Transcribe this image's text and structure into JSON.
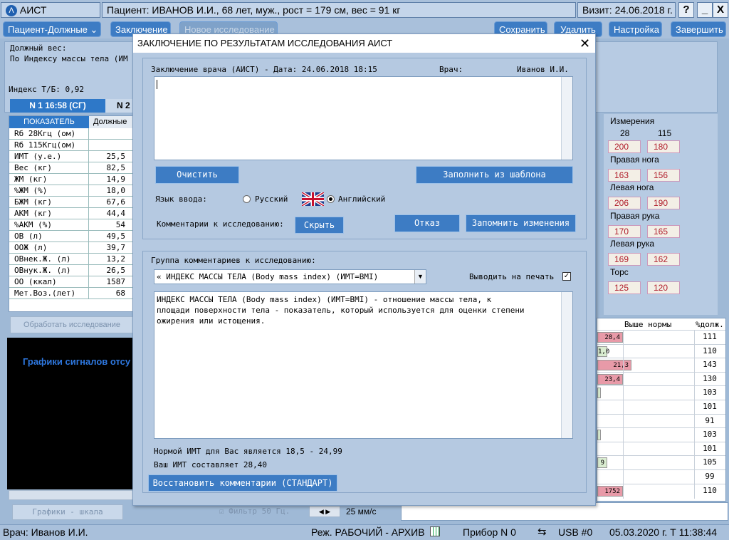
{
  "app": {
    "title": "АИСТ",
    "patient_label": "Пациент:",
    "patient": "ИВАНОВ И.И., 68 лет, муж., рост = 179 см, вес = 91 кг",
    "visit_label": "Визит:",
    "visit_date": "24.06.2018 г.",
    "help": "?",
    "minimize": "_",
    "close": "X"
  },
  "toolbar": {
    "mode": "Пациент-Должные",
    "conclusion": "Заключение",
    "new_study": "Новое исследование",
    "save": "Сохранить",
    "delete": "Удалить",
    "settings": "Настройка",
    "exit": "Завершить"
  },
  "left": {
    "due_weight": "Должный вес:",
    "bmi_ref": "По Индексу массы тела (ИМ",
    "index_tb": "Индекс Т/Б:  0,92",
    "tab1": "N 1  16:58 (СГ)",
    "tab2": "N 2",
    "col_indicator": "ПОКАЗАТЕЛЬ",
    "col_due": "Должные",
    "rows": [
      {
        "name": "Rб 28Кгц  (ом)",
        "val": ""
      },
      {
        "name": "Rб 115Кгц(ом)",
        "val": ""
      },
      {
        "name": "ИМТ     (у.е.)",
        "val": "25,5"
      },
      {
        "name": "Вес       (кг)",
        "val": "82,5"
      },
      {
        "name": "ЖМ        (кг)",
        "val": "14,9"
      },
      {
        "name": "%ЖМ        (%)",
        "val": "18,0"
      },
      {
        "name": "БЖМ       (кг)",
        "val": "67,6"
      },
      {
        "name": "АКМ       (кг)",
        "val": "44,4"
      },
      {
        "name": "%АКМ       (%)",
        "val": "54"
      },
      {
        "name": "ОВ         (л)",
        "val": "49,5"
      },
      {
        "name": "ООЖ        (л)",
        "val": "39,7"
      },
      {
        "name": "ОВнек.Ж.   (л)",
        "val": "13,2"
      },
      {
        "name": "ОВнук.Ж.   (л)",
        "val": "26,5"
      },
      {
        "name": "ОО      (ккал)",
        "val": "1587"
      },
      {
        "name": "Мет.Воз.(лет)",
        "val": "68"
      }
    ],
    "process": "Обработать исследование",
    "no_signals": "Графики сигналов отсу",
    "graphs_scale": "Графики - шкала",
    "filter": "Фильтр 50 Гц.",
    "speed": "25 мм/с"
  },
  "measure": {
    "title": "Измерения",
    "f1": "28",
    "f2": "115",
    "groups": [
      {
        "label": "",
        "a": "200",
        "b": "180"
      },
      {
        "label": "Правая нога",
        "a": "163",
        "b": "156"
      },
      {
        "label": "Левая нога",
        "a": "206",
        "b": "190"
      },
      {
        "label": "Правая рука",
        "a": "170",
        "b": "165"
      },
      {
        "label": "Левая рука",
        "a": "169",
        "b": "162"
      },
      {
        "label": "Торс",
        "a": "125",
        "b": "120"
      }
    ]
  },
  "rtable": {
    "above": "Выше нормы",
    "pct": "%долж.",
    "rows": [
      {
        "bar": "28,4",
        "pct": "111",
        "color": "#e89aa8"
      },
      {
        "bar": "1,0",
        "pct": "110",
        "color": "#d9ecd0"
      },
      {
        "bar": "21,3",
        "pct": "143",
        "color": "#e89aa8"
      },
      {
        "bar": "23,4",
        "pct": "130",
        "color": "#e89aa8"
      },
      {
        "bar": "",
        "pct": "103",
        "color": "#d9ecd0"
      },
      {
        "bar": "",
        "pct": "101",
        "color": ""
      },
      {
        "bar": "",
        "pct": "91",
        "color": ""
      },
      {
        "bar": "",
        "pct": "103",
        "color": "#d9ecd0"
      },
      {
        "bar": "",
        "pct": "101",
        "color": ""
      },
      {
        "bar": "9",
        "pct": "105",
        "color": "#d9ecd0"
      },
      {
        "bar": "",
        "pct": "99",
        "color": ""
      },
      {
        "bar": "1752",
        "pct": "110",
        "color": "#e89aa8"
      }
    ]
  },
  "dialog": {
    "title": "ЗАКЛЮЧЕНИЕ ПО РЕЗУЛЬТАТАМ ИССЛЕДОВАНИЯ АИСТ",
    "close": "X",
    "header": "Заключение врача (АИСТ) - Дата: 24.06.2018  18:15",
    "doctor_label": "Врач:",
    "doctor": "Иванов И.И.",
    "clear": "Очистить",
    "fill_template": "Заполнить из шаблона",
    "lang_label": "Язык ввода:",
    "lang_ru": "Русский",
    "lang_en": "Английский",
    "comments_label": "Комментарии к исследованию:",
    "hide": "Скрыть",
    "cancel": "Отказ",
    "remember": "Запомнить изменения",
    "group_label": "Группа комментариев к исследованию:",
    "group_select": "« ИНДЕКС МАССЫ ТЕЛА (Body mass index) (ИМТ=BMI)",
    "print_label": "Выводить на печать",
    "comment_text": "ИНДЕКС МАССЫ ТЕЛА (Body mass index) (ИМТ=BMI) - отношение массы тела, к площади поверхности тела - показатель, который используется для оценки степени ожирения или истощения.",
    "norm": "Нормой ИМТ для Вас является  18,5 - 24,99",
    "your_bmi": "Ваш ИМТ составляет   28,40",
    "restore": "Восстановить комментарии (СТАНДАРТ)"
  },
  "status": {
    "doctor": "Врач: Иванов И.И.",
    "mode": "Реж. РАБОЧИЙ - АРХИВ",
    "device": "Прибор N 0",
    "usb": "USB #0",
    "datetime": "05.03.2020 г.  Т 11:38:44"
  }
}
